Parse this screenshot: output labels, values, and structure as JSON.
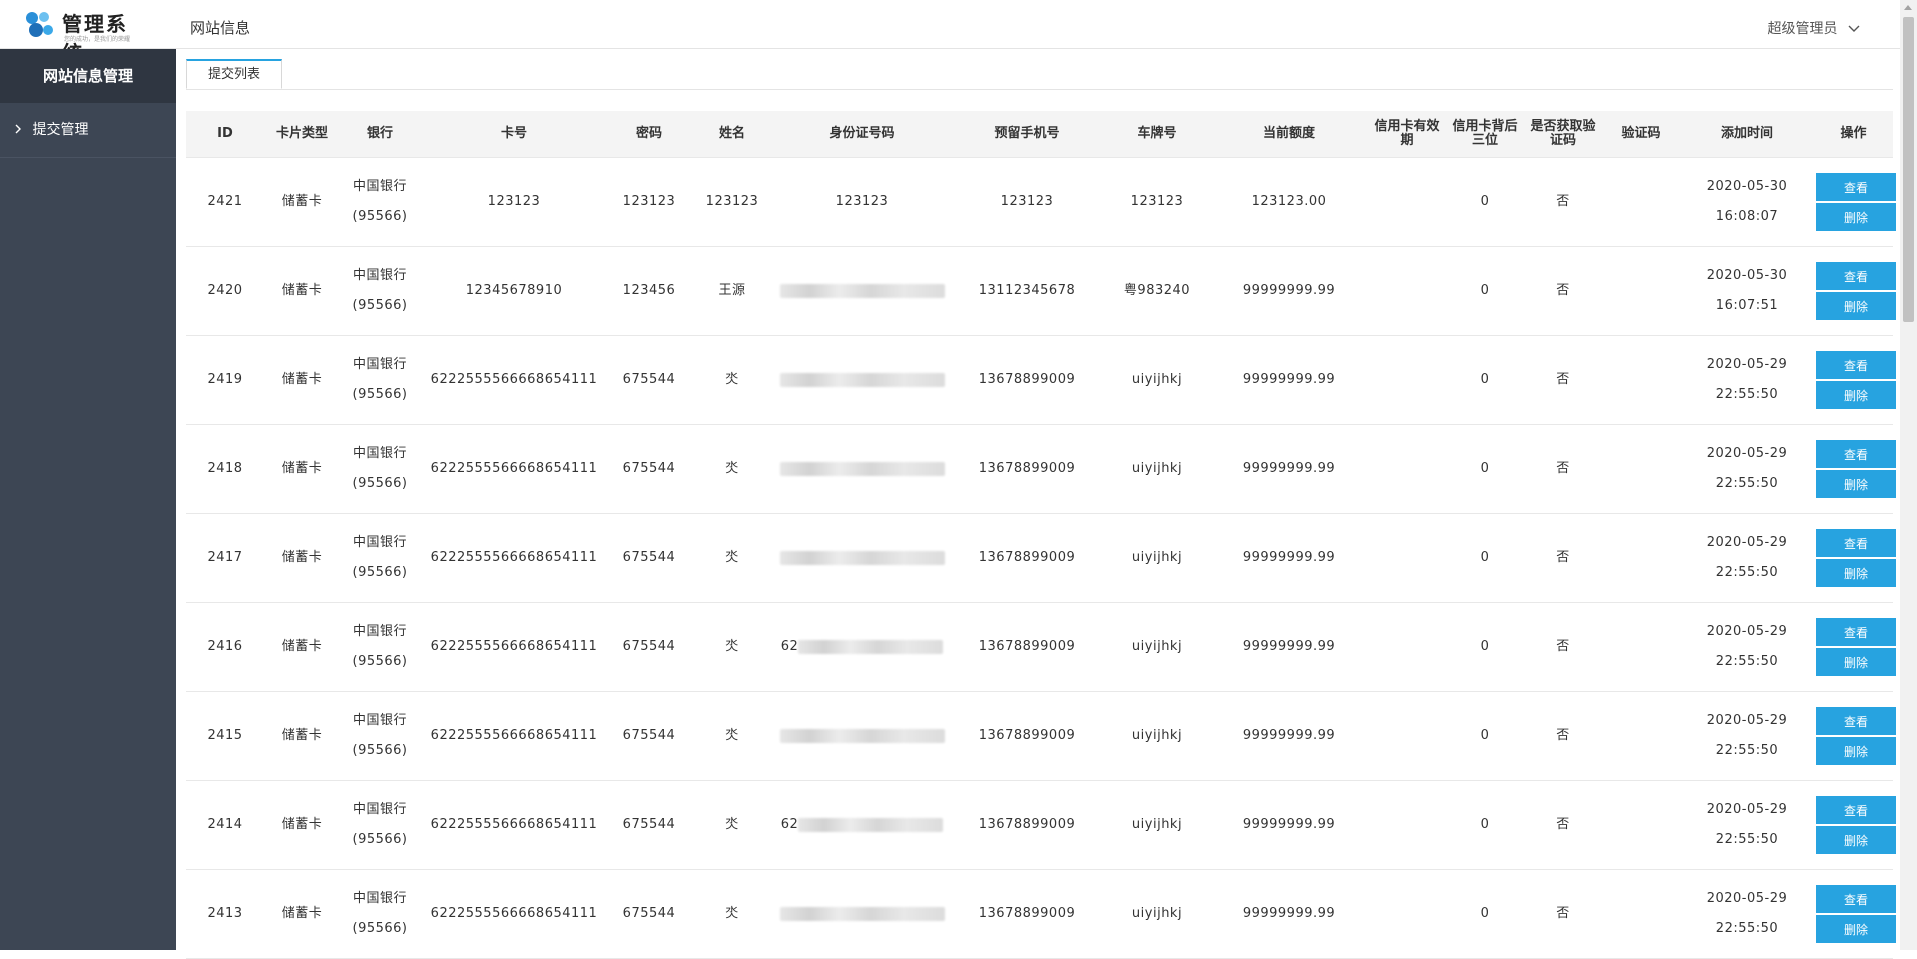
{
  "header": {
    "logo_title": "管理系统",
    "logo_sub": "您的成功，是我们的荣耀",
    "page_title": "网站信息",
    "user_label": "超级管理员"
  },
  "sidebar": {
    "title": "网站信息管理",
    "items": [
      {
        "label": "提交管理"
      }
    ]
  },
  "tabs": [
    {
      "label": "提交列表"
    }
  ],
  "table": {
    "columns": [
      "ID",
      "卡片类型",
      "银行",
      "卡号",
      "密码",
      "姓名",
      "身份证号码",
      "预留手机号",
      "车牌号",
      "当前额度",
      "信用卡有效期",
      "信用卡背后三位",
      "是否获取验证码",
      "验证码",
      "添加时间",
      "操作"
    ],
    "view_label": "查看",
    "delete_label": "删除",
    "rows": [
      {
        "id": "2421",
        "type": "储蓄卡",
        "bank": "中国银行",
        "bank_code": "(95566)",
        "card": "123123",
        "pwd": "123123",
        "name": "123123",
        "idcard": "123123",
        "phone": "123123",
        "plate": "123123",
        "limit": "123123.00",
        "expiry": "",
        "cvv": "0",
        "got_code": "否",
        "code": "",
        "date": "2020-05-30",
        "time": "16:08:07"
      },
      {
        "id": "2420",
        "type": "储蓄卡",
        "bank": "中国银行",
        "bank_code": "(95566)",
        "card": "12345678910",
        "pwd": "123456",
        "name": "王源",
        "idcard": "",
        "phone": "13112345678",
        "plate": "粤983240",
        "limit": "99999999.99",
        "expiry": "",
        "cvv": "0",
        "got_code": "否",
        "code": "",
        "date": "2020-05-30",
        "time": "16:07:51"
      },
      {
        "id": "2419",
        "type": "储蓄卡",
        "bank": "中国银行",
        "bank_code": "(95566)",
        "card": "6222555566668654111",
        "pwd": "675544",
        "name": "氼",
        "idcard": "",
        "phone": "13678899009",
        "plate": "uiyijhkj",
        "limit": "99999999.99",
        "expiry": "",
        "cvv": "0",
        "got_code": "否",
        "code": "",
        "date": "2020-05-29",
        "time": "22:55:50"
      },
      {
        "id": "2418",
        "type": "储蓄卡",
        "bank": "中国银行",
        "bank_code": "(95566)",
        "card": "6222555566668654111",
        "pwd": "675544",
        "name": "氼",
        "idcard": "",
        "phone": "13678899009",
        "plate": "uiyijhkj",
        "limit": "99999999.99",
        "expiry": "",
        "cvv": "0",
        "got_code": "否",
        "code": "",
        "date": "2020-05-29",
        "time": "22:55:50"
      },
      {
        "id": "2417",
        "type": "储蓄卡",
        "bank": "中国银行",
        "bank_code": "(95566)",
        "card": "6222555566668654111",
        "pwd": "675544",
        "name": "氼",
        "idcard": "",
        "phone": "13678899009",
        "plate": "uiyijhkj",
        "limit": "99999999.99",
        "expiry": "",
        "cvv": "0",
        "got_code": "否",
        "code": "",
        "date": "2020-05-29",
        "time": "22:55:50"
      },
      {
        "id": "2416",
        "type": "储蓄卡",
        "bank": "中国银行",
        "bank_code": "(95566)",
        "card": "6222555566668654111",
        "pwd": "675544",
        "name": "氼",
        "idcard": "62",
        "phone": "13678899009",
        "plate": "uiyijhkj",
        "limit": "99999999.99",
        "expiry": "",
        "cvv": "0",
        "got_code": "否",
        "code": "",
        "date": "2020-05-29",
        "time": "22:55:50"
      },
      {
        "id": "2415",
        "type": "储蓄卡",
        "bank": "中国银行",
        "bank_code": "(95566)",
        "card": "6222555566668654111",
        "pwd": "675544",
        "name": "氼",
        "idcard": "",
        "phone": "13678899009",
        "plate": "uiyijhkj",
        "limit": "99999999.99",
        "expiry": "",
        "cvv": "0",
        "got_code": "否",
        "code": "",
        "date": "2020-05-29",
        "time": "22:55:50"
      },
      {
        "id": "2414",
        "type": "储蓄卡",
        "bank": "中国银行",
        "bank_code": "(95566)",
        "card": "6222555566668654111",
        "pwd": "675544",
        "name": "氼",
        "idcard": "62",
        "phone": "13678899009",
        "plate": "uiyijhkj",
        "limit": "99999999.99",
        "expiry": "",
        "cvv": "0",
        "got_code": "否",
        "code": "",
        "date": "2020-05-29",
        "time": "22:55:50"
      },
      {
        "id": "2413",
        "type": "储蓄卡",
        "bank": "中国银行",
        "bank_code": "(95566)",
        "card": "6222555566668654111",
        "pwd": "675544",
        "name": "氼",
        "idcard": "",
        "phone": "13678899009",
        "plate": "uiyijhkj",
        "limit": "99999999.99",
        "expiry": "",
        "cvv": "0",
        "got_code": "否",
        "code": "",
        "date": "2020-05-29",
        "time": "22:55:50"
      }
    ]
  },
  "colors": {
    "accent": "#27a3e0",
    "sidebar_bg": "#3d4654",
    "sidebar_head": "#2f3641"
  }
}
